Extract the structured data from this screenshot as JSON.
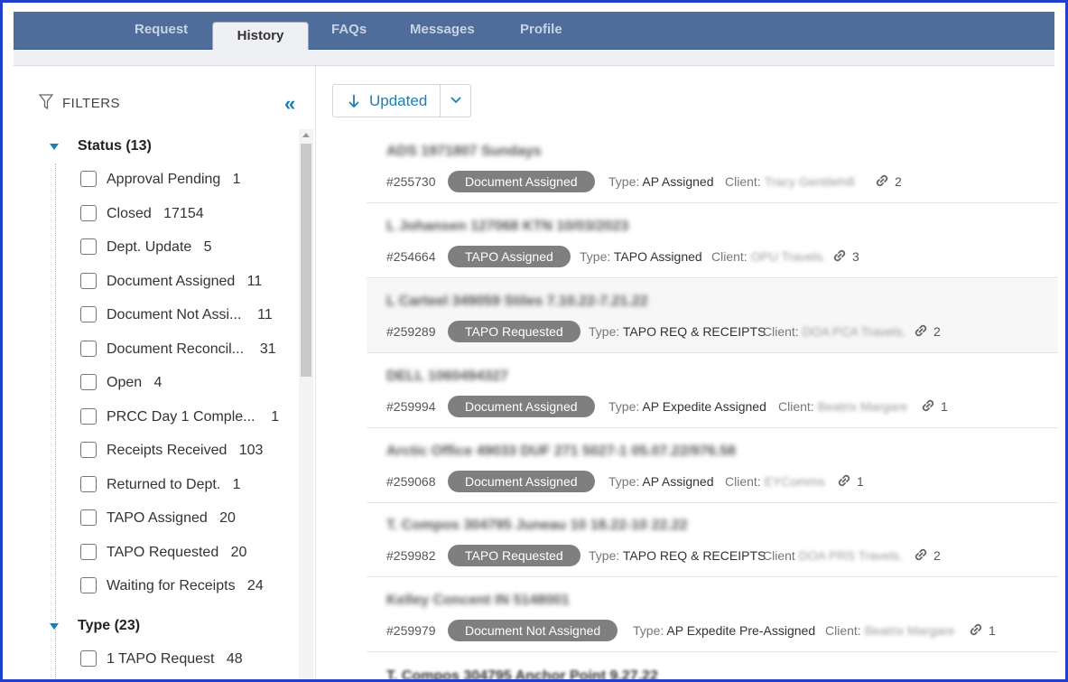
{
  "nav": {
    "tabs": [
      {
        "label": "Request"
      },
      {
        "label": "History"
      },
      {
        "label": "FAQs"
      },
      {
        "label": "Messages"
      },
      {
        "label": "Profile"
      }
    ],
    "active": "History"
  },
  "filters": {
    "heading": "FILTERS",
    "collapse_glyph": "«",
    "status": {
      "label": "Status (13)",
      "items": [
        {
          "label": "Approval Pending",
          "count": "1"
        },
        {
          "label": "Closed",
          "count": "17154"
        },
        {
          "label": "Dept. Update",
          "count": "5"
        },
        {
          "label": "Document Assigned",
          "count": "11"
        },
        {
          "label": "Document Not Assi...",
          "count": "11"
        },
        {
          "label": "Document Reconcil...",
          "count": "31"
        },
        {
          "label": "Open",
          "count": "4"
        },
        {
          "label": "PRCC Day 1 Comple...",
          "count": "1"
        },
        {
          "label": "Receipts Received",
          "count": "103"
        },
        {
          "label": "Returned to Dept.",
          "count": "1"
        },
        {
          "label": "TAPO Assigned",
          "count": "20"
        },
        {
          "label": "TAPO Requested",
          "count": "20"
        },
        {
          "label": "Waiting for Receipts",
          "count": "24"
        }
      ]
    },
    "type": {
      "label": "Type (23)",
      "items": [
        {
          "label": "1 TAPO Request",
          "count": "48"
        }
      ]
    }
  },
  "sort": {
    "label": "Updated"
  },
  "results": [
    {
      "title": "ADS 1971807 Sundays",
      "id": "#255730",
      "status": "Document Assigned",
      "type_label": "Type:",
      "type": "AP Assigned",
      "client_label": "Client:",
      "client": "Tracy Gentilehill",
      "links": "2"
    },
    {
      "title": "L Johansen 127068 KTN 10/03/2023",
      "id": "#254664",
      "status": "TAPO Assigned",
      "type_label": "Type:",
      "type": "TAPO Assigned",
      "client_label": "Client:",
      "client": "OPU Travels.",
      "links": "3"
    },
    {
      "title": "L Carteel 349059 Stiles 7.10.22-7.21.22",
      "id": "#259289",
      "status": "TAPO Requested",
      "type_label": "Type:",
      "type": "TAPO REQ & RECEIPTS",
      "client_label": "Client:",
      "client": "DOA PCA Travels.",
      "links": "2"
    },
    {
      "title": "DELL 1060494327",
      "id": "#259994",
      "status": "Document Assigned",
      "type_label": "Type:",
      "type": "AP Expedite Assigned",
      "client_label": "Client:",
      "client": "Beatrix Margare",
      "links": "1"
    },
    {
      "title": "Arctic Office 49033 DUF 271 5027-1 05.07.22/976.58",
      "id": "#259068",
      "status": "Document Assigned",
      "type_label": "Type:",
      "type": "AP Assigned",
      "client_label": "Client:",
      "client": "EYComms",
      "links": "1"
    },
    {
      "title": "T. Compos 304795 Juneau 10 18.22-10 22.22",
      "id": "#259982",
      "status": "TAPO Requested",
      "type_label": "Type:",
      "type": "TAPO REQ & RECEIPTS",
      "client_label": "Client",
      "client": "DOA PRS Travels.",
      "links": "2"
    },
    {
      "title": "Kelley Concent IN 5148001",
      "id": "#259979",
      "status": "Document Not Assigned",
      "type_label": "Type:",
      "type": "AP Expedite Pre-Assigned",
      "client_label": "Client:",
      "client": "Beatrix Margare",
      "links": "1"
    }
  ],
  "partial_row": "T. Compos 304795 Anchor Point 9.27.22"
}
